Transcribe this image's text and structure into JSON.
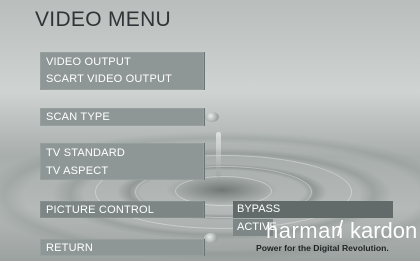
{
  "menu": {
    "title": "VIDEO MENU",
    "items": [
      {
        "label": "VIDEO OUTPUT"
      },
      {
        "label": "SCART VIDEO OUTPUT"
      },
      {
        "label": "SCAN TYPE"
      },
      {
        "label": "TV STANDARD"
      },
      {
        "label": "TV ASPECT"
      },
      {
        "label": "PICTURE CONTROL"
      },
      {
        "label": "RETURN"
      }
    ]
  },
  "submenu": {
    "options": [
      {
        "label": "BYPASS"
      },
      {
        "label": "ACTIVE"
      }
    ]
  },
  "brand": {
    "name_left": "harman",
    "slash": "/",
    "name_right": "kardon",
    "tagline": "Power for the Digital Revolution."
  },
  "colors": {
    "panel": "#8f9796",
    "submenu_selected": "#626b6a",
    "text": "#ffffff"
  }
}
